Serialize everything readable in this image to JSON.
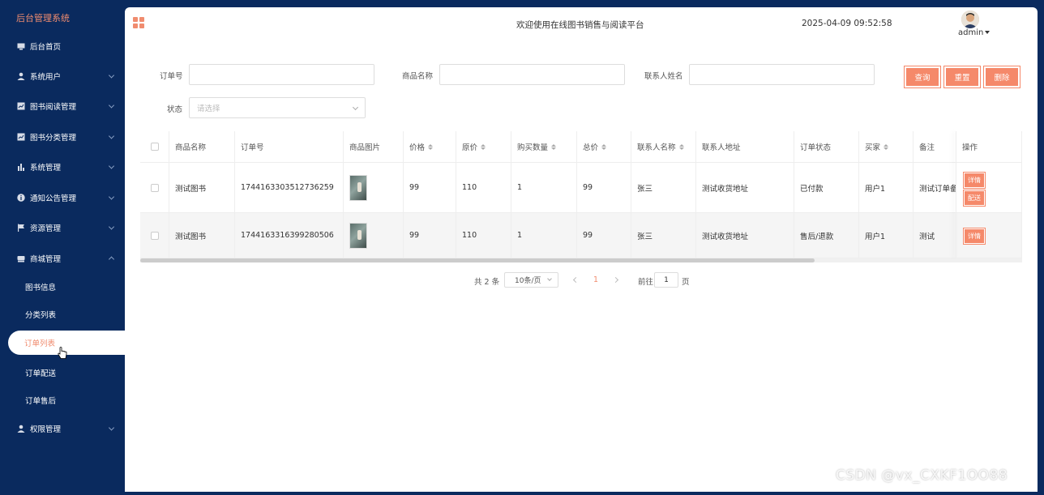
{
  "sidebar": {
    "title": "后台管理系统",
    "items": [
      {
        "label": "后台首页",
        "icon": "monitor-icon"
      },
      {
        "label": "系统用户",
        "icon": "user-icon"
      },
      {
        "label": "图书阅读管理",
        "icon": "chart-box-icon"
      },
      {
        "label": "图书分类管理",
        "icon": "chart-box-icon"
      },
      {
        "label": "系统管理",
        "icon": "bar-chart-icon"
      },
      {
        "label": "通知公告管理",
        "icon": "info-icon"
      },
      {
        "label": "资源管理",
        "icon": "flag-icon"
      },
      {
        "label": "商城管理",
        "icon": "cart-icon"
      }
    ],
    "sub_items": [
      "图书信息",
      "分类列表",
      "订单列表",
      "订单配送",
      "订单售后"
    ],
    "active_sub": "订单列表",
    "bottom_item": {
      "label": "权限管理",
      "icon": "user-icon"
    }
  },
  "header": {
    "title": "欢迎使用在线图书销售与阅读平台",
    "datetime": "2025-04-09 09:52:58",
    "username": "admin"
  },
  "search": {
    "order_no_label": "订单号",
    "product_name_label": "商品名称",
    "contact_name_label": "联系人姓名",
    "status_label": "状态",
    "status_placeholder": "请选择",
    "query_button": "查询",
    "reset_button": "重置",
    "delete_button": "删除"
  },
  "table": {
    "columns": [
      "商品名称",
      "订单号",
      "商品图片",
      "价格",
      "原价",
      "购买数量",
      "总价",
      "联系人名称",
      "联系人地址",
      "订单状态",
      "买家",
      "备注",
      "操作"
    ],
    "rows": [
      {
        "product": "测试图书",
        "order_no": "1744163303512736259",
        "price": "99",
        "orig_price": "110",
        "qty": "1",
        "total": "99",
        "contact": "张三",
        "address": "测试收货地址",
        "status": "已付款",
        "buyer": "用户1",
        "remark": "测试订单备",
        "actions": [
          "详情",
          "配送"
        ]
      },
      {
        "product": "测试图书",
        "order_no": "1744163316399280506",
        "price": "99",
        "orig_price": "110",
        "qty": "1",
        "total": "99",
        "contact": "张三",
        "address": "测试收货地址",
        "status": "售后/退款",
        "buyer": "用户1",
        "remark": "测试",
        "actions": [
          "详情"
        ]
      }
    ]
  },
  "pagination": {
    "total_text": "共 2 条",
    "page_size": "10条/页",
    "current_page": "1",
    "goto_prefix": "前往",
    "goto_value": "1",
    "goto_suffix": "页"
  },
  "watermark": "CSDN @vx_CXKF1OO88",
  "colors": {
    "sidebar_bg": "#0a2a5e",
    "accent": "#f5896a"
  }
}
